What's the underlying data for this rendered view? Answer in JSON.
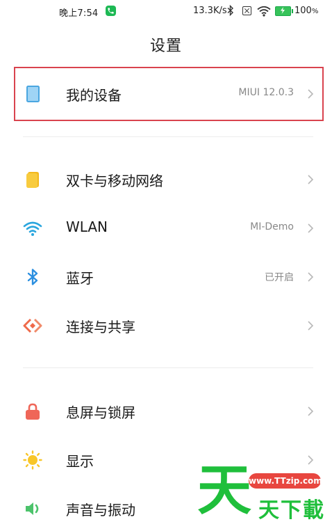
{
  "status_bar": {
    "time": "晚上7:54",
    "net_speed": "13.3K/s",
    "battery_pct": "100",
    "battery_unit": "%"
  },
  "header": {
    "title": "设置"
  },
  "rows": [
    {
      "label": "我的设备",
      "value": "MIUI 12.0.3",
      "icon": "tablet-icon",
      "color": "#6ab8ea"
    },
    {
      "label": "双卡与移动网络",
      "value": "",
      "icon": "sim-card-icon",
      "color": "#f5c026"
    },
    {
      "label": "WLAN",
      "value": "MI-Demo",
      "icon": "wifi-icon",
      "color": "#2aa6de"
    },
    {
      "label": "蓝牙",
      "value": "已开启",
      "icon": "bluetooth-icon",
      "color": "#2b8fe0"
    },
    {
      "label": "连接与共享",
      "value": "",
      "icon": "connection-share-icon",
      "color": "#ef6a4a"
    },
    {
      "label": "息屏与锁屏",
      "value": "",
      "icon": "lock-icon",
      "color": "#ef6658"
    },
    {
      "label": "显示",
      "value": "",
      "icon": "sun-icon",
      "color": "#f8c629"
    },
    {
      "label": "声音与振动",
      "value": "",
      "icon": "speaker-icon",
      "color": "#4cc36b"
    }
  ],
  "watermark": {
    "big_char": "天",
    "url": "www.TTzip.com",
    "sub_text": "天下載"
  }
}
